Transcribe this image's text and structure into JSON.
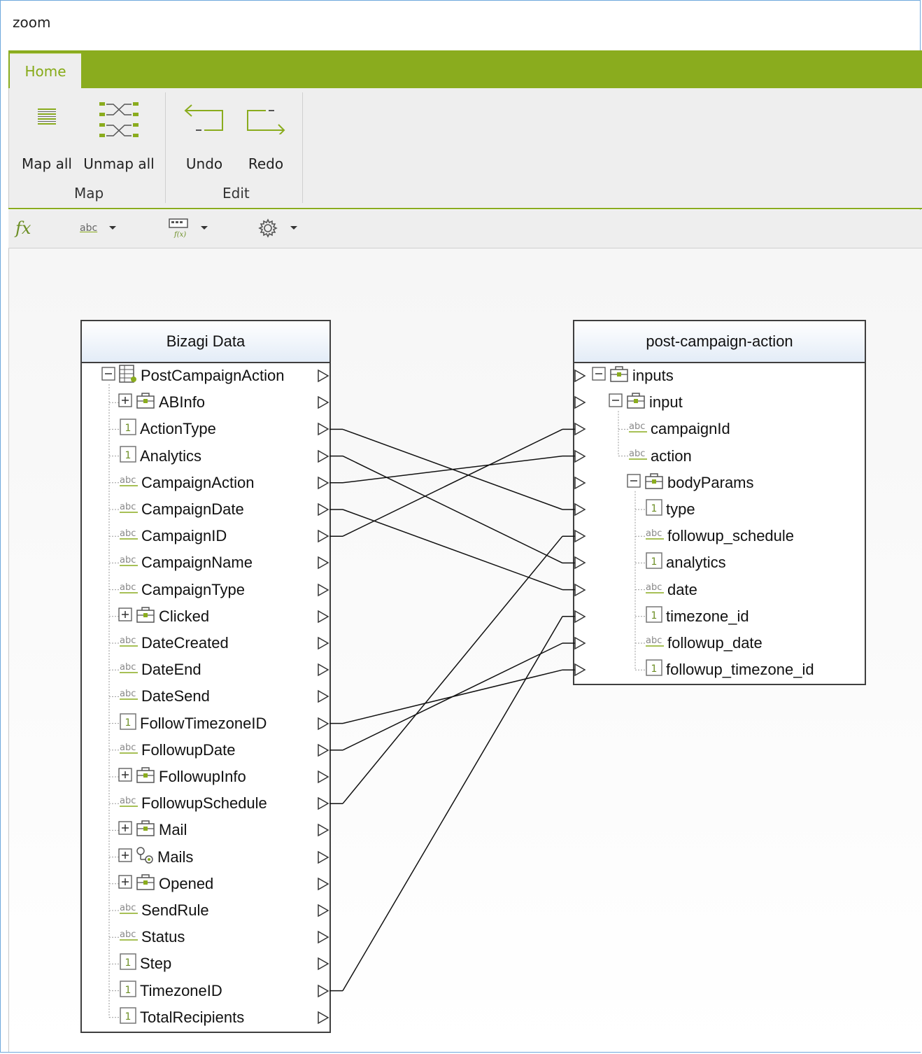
{
  "window": {
    "title": "zoom"
  },
  "ribbon": {
    "tab": "Home",
    "groups": [
      {
        "label": "Map",
        "buttons": [
          "Map all",
          "Unmap all"
        ]
      },
      {
        "label": "Edit",
        "buttons": [
          "Undo",
          "Redo"
        ]
      }
    ],
    "accent": "#8aac1e"
  },
  "toolbar": {
    "items": [
      "fx-icon",
      "abc-type-icon",
      "formula-icon",
      "gear-icon"
    ],
    "fx_label": "fx",
    "abc_label": "abc"
  },
  "source": {
    "title": "Bizagi Data",
    "root": "PostCampaignAction",
    "items": [
      {
        "label": "ABInfo",
        "type": "entity",
        "expand": "+"
      },
      {
        "label": "ActionType",
        "type": "number"
      },
      {
        "label": "Analytics",
        "type": "number"
      },
      {
        "label": "CampaignAction",
        "type": "string"
      },
      {
        "label": "CampaignDate",
        "type": "string"
      },
      {
        "label": "CampaignID",
        "type": "string"
      },
      {
        "label": "CampaignName",
        "type": "string"
      },
      {
        "label": "CampaignType",
        "type": "string"
      },
      {
        "label": "Clicked",
        "type": "entity",
        "expand": "+"
      },
      {
        "label": "DateCreated",
        "type": "string"
      },
      {
        "label": "DateEnd",
        "type": "string"
      },
      {
        "label": "DateSend",
        "type": "string"
      },
      {
        "label": "FollowTimezoneID",
        "type": "number"
      },
      {
        "label": "FollowupDate",
        "type": "string"
      },
      {
        "label": "FollowupInfo",
        "type": "entity",
        "expand": "+"
      },
      {
        "label": "FollowupSchedule",
        "type": "string"
      },
      {
        "label": "Mail",
        "type": "entity",
        "expand": "+"
      },
      {
        "label": "Mails",
        "type": "collection",
        "expand": "+"
      },
      {
        "label": "Opened",
        "type": "entity",
        "expand": "+"
      },
      {
        "label": "SendRule",
        "type": "string"
      },
      {
        "label": "Status",
        "type": "string"
      },
      {
        "label": "Step",
        "type": "number"
      },
      {
        "label": "TimezoneID",
        "type": "number"
      },
      {
        "label": "TotalRecipients",
        "type": "number"
      }
    ]
  },
  "target": {
    "title": "post-campaign-action",
    "items": [
      {
        "label": "inputs",
        "type": "entity",
        "expand": "-"
      },
      {
        "label": "input",
        "type": "entity",
        "expand": "-"
      },
      {
        "label": "campaignId",
        "type": "string"
      },
      {
        "label": "action",
        "type": "string"
      },
      {
        "label": "bodyParams",
        "type": "entity",
        "expand": "-"
      },
      {
        "label": "type",
        "type": "number"
      },
      {
        "label": "followup_schedule",
        "type": "string"
      },
      {
        "label": "analytics",
        "type": "number"
      },
      {
        "label": "date",
        "type": "string"
      },
      {
        "label": "timezone_id",
        "type": "number"
      },
      {
        "label": "followup_date",
        "type": "string"
      },
      {
        "label": "followup_timezone_id",
        "type": "number"
      }
    ]
  },
  "mappings": [
    {
      "from": "ActionType",
      "to": "type"
    },
    {
      "from": "Analytics",
      "to": "analytics"
    },
    {
      "from": "CampaignAction",
      "to": "action"
    },
    {
      "from": "CampaignDate",
      "to": "date"
    },
    {
      "from": "CampaignID",
      "to": "campaignId"
    },
    {
      "from": "FollowTimezoneID",
      "to": "followup_timezone_id"
    },
    {
      "from": "FollowupDate",
      "to": "followup_date"
    },
    {
      "from": "FollowupSchedule",
      "to": "followup_schedule"
    },
    {
      "from": "TimezoneID",
      "to": "timezone_id"
    }
  ]
}
